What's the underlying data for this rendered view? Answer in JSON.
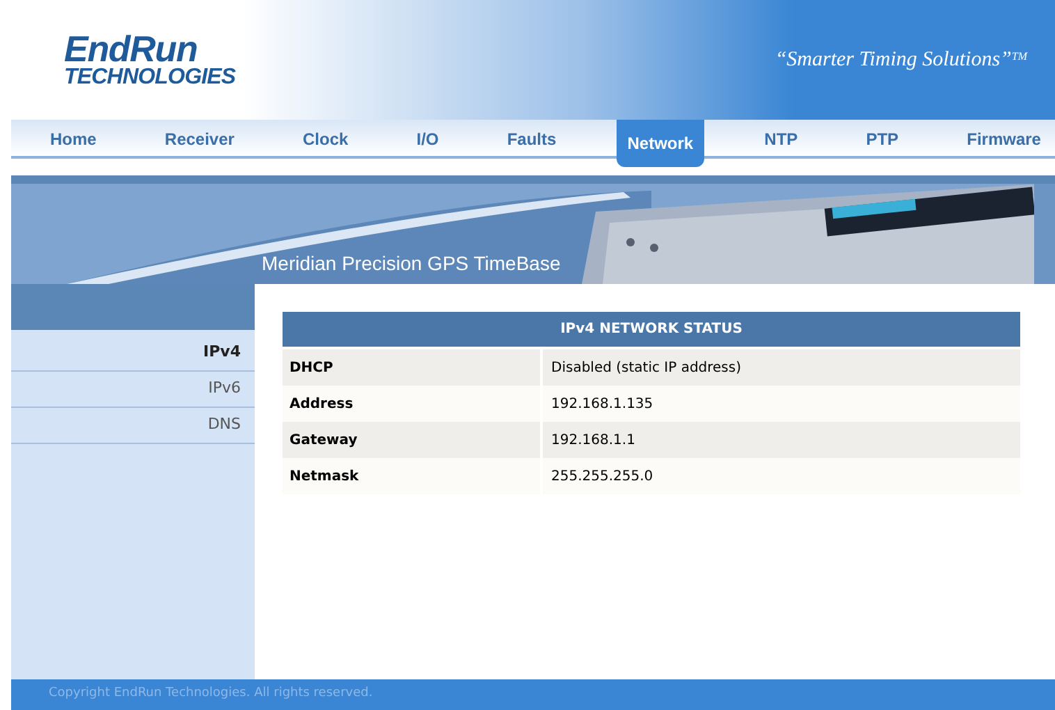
{
  "logo": {
    "line1": "EndRun",
    "line2": "TECHNOLOGIES"
  },
  "tagline": {
    "text": "“Smarter Timing Solutions”",
    "mark": "TM"
  },
  "nav": [
    {
      "label": "Home",
      "selected": false
    },
    {
      "label": "Receiver",
      "selected": false
    },
    {
      "label": "Clock",
      "selected": false
    },
    {
      "label": "I/O",
      "selected": false
    },
    {
      "label": "Faults",
      "selected": false
    },
    {
      "label": "Network",
      "selected": true
    },
    {
      "label": "NTP",
      "selected": false
    },
    {
      "label": "PTP",
      "selected": false
    },
    {
      "label": "Firmware",
      "selected": false
    }
  ],
  "banner": {
    "title": "Meridian Precision GPS TimeBase"
  },
  "sidebar": {
    "items": [
      {
        "label": "IPv4",
        "selected": true
      },
      {
        "label": "IPv6",
        "selected": false
      },
      {
        "label": "DNS",
        "selected": false
      }
    ]
  },
  "table": {
    "title": "IPv4 NETWORK STATUS",
    "rows": [
      {
        "label": "DHCP",
        "value": "Disabled (static IP address)"
      },
      {
        "label": "Address",
        "value": "192.168.1.135"
      },
      {
        "label": "Gateway",
        "value": "192.168.1.1"
      },
      {
        "label": "Netmask",
        "value": "255.255.255.0"
      }
    ]
  },
  "footer": "Copyright EndRun Technologies. All rights reserved."
}
